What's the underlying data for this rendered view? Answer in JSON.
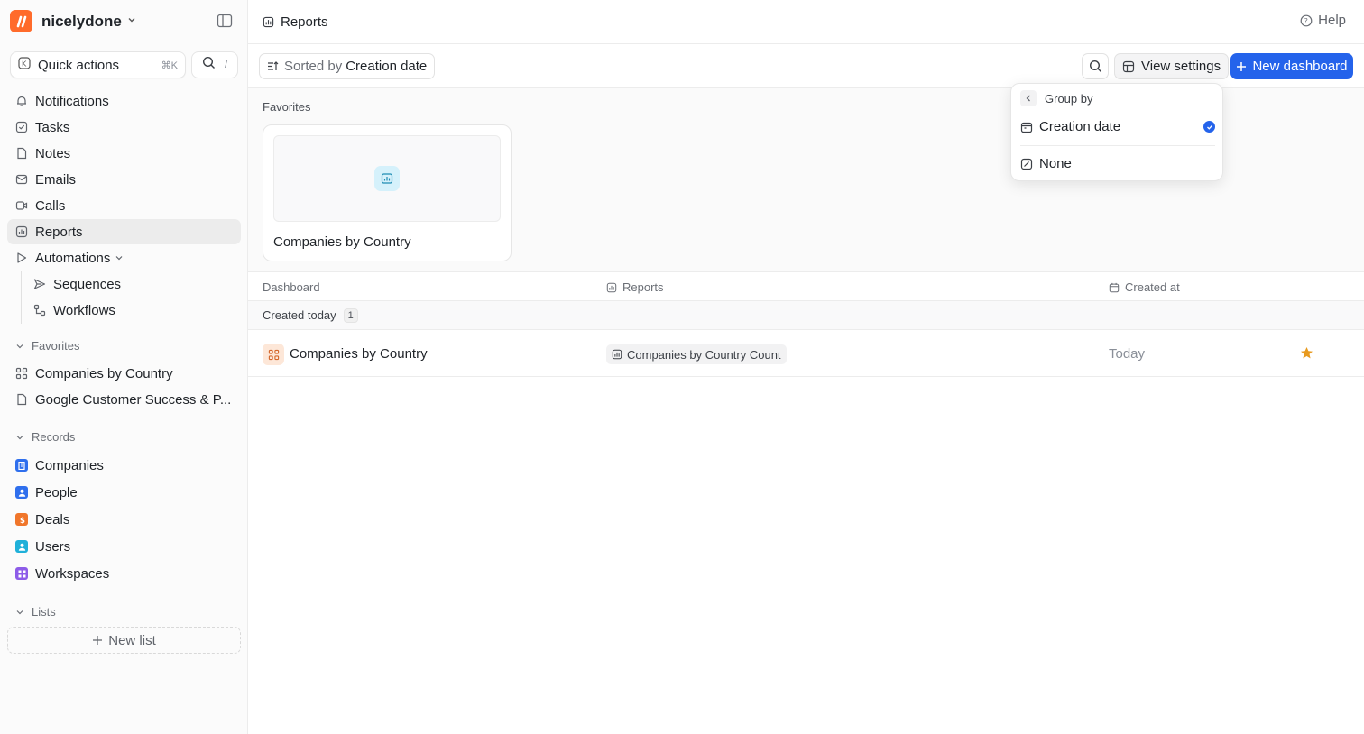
{
  "workspace": {
    "name": "nicelydone",
    "logo_color": "#ff6b2b"
  },
  "quick_actions": {
    "label": "Quick actions",
    "shortcut": "⌘K",
    "search_shortcut": "/"
  },
  "nav": [
    {
      "label": "Notifications",
      "icon": "bell-icon"
    },
    {
      "label": "Tasks",
      "icon": "checkbox-icon"
    },
    {
      "label": "Notes",
      "icon": "note-icon"
    },
    {
      "label": "Emails",
      "icon": "mail-icon"
    },
    {
      "label": "Calls",
      "icon": "video-icon"
    },
    {
      "label": "Reports",
      "icon": "chart-icon",
      "active": true
    },
    {
      "label": "Automations",
      "icon": "play-icon"
    },
    {
      "label": "Sequences",
      "icon": "send-icon"
    },
    {
      "label": "Workflows",
      "icon": "workflow-icon"
    }
  ],
  "favorites": {
    "title": "Favorites",
    "items": [
      "Companies by Country",
      "Google Customer Success & P..."
    ]
  },
  "records": {
    "title": "Records",
    "items": [
      {
        "label": "Companies",
        "color": "#2f6fed"
      },
      {
        "label": "People",
        "color": "#2f6fed"
      },
      {
        "label": "Deals",
        "color": "#f0762b"
      },
      {
        "label": "Users",
        "color": "#1fb0d9"
      },
      {
        "label": "Workspaces",
        "color": "#8d5ce8"
      }
    ]
  },
  "lists": {
    "title": "Lists",
    "new_list": "New list"
  },
  "header": {
    "title": "Reports",
    "help": "Help"
  },
  "toolbar": {
    "sort_prefix": "Sorted by",
    "sort_value": "Creation date",
    "view_settings": "View settings",
    "new_dashboard": "New dashboard",
    "accent": "#2463eb"
  },
  "favorites_panel": {
    "title": "Favorites",
    "card": "Companies by Country"
  },
  "table": {
    "columns": [
      "Dashboard",
      "Reports",
      "Created at"
    ],
    "group": {
      "label": "Created today",
      "count": "1"
    },
    "rows": [
      {
        "name": "Companies by Country",
        "report": "Companies by Country Count",
        "created": "Today",
        "favorite": true
      }
    ]
  },
  "dropdown": {
    "title": "Group by",
    "options": [
      {
        "label": "Creation date",
        "selected": true
      },
      {
        "label": "None",
        "selected": false
      }
    ]
  }
}
